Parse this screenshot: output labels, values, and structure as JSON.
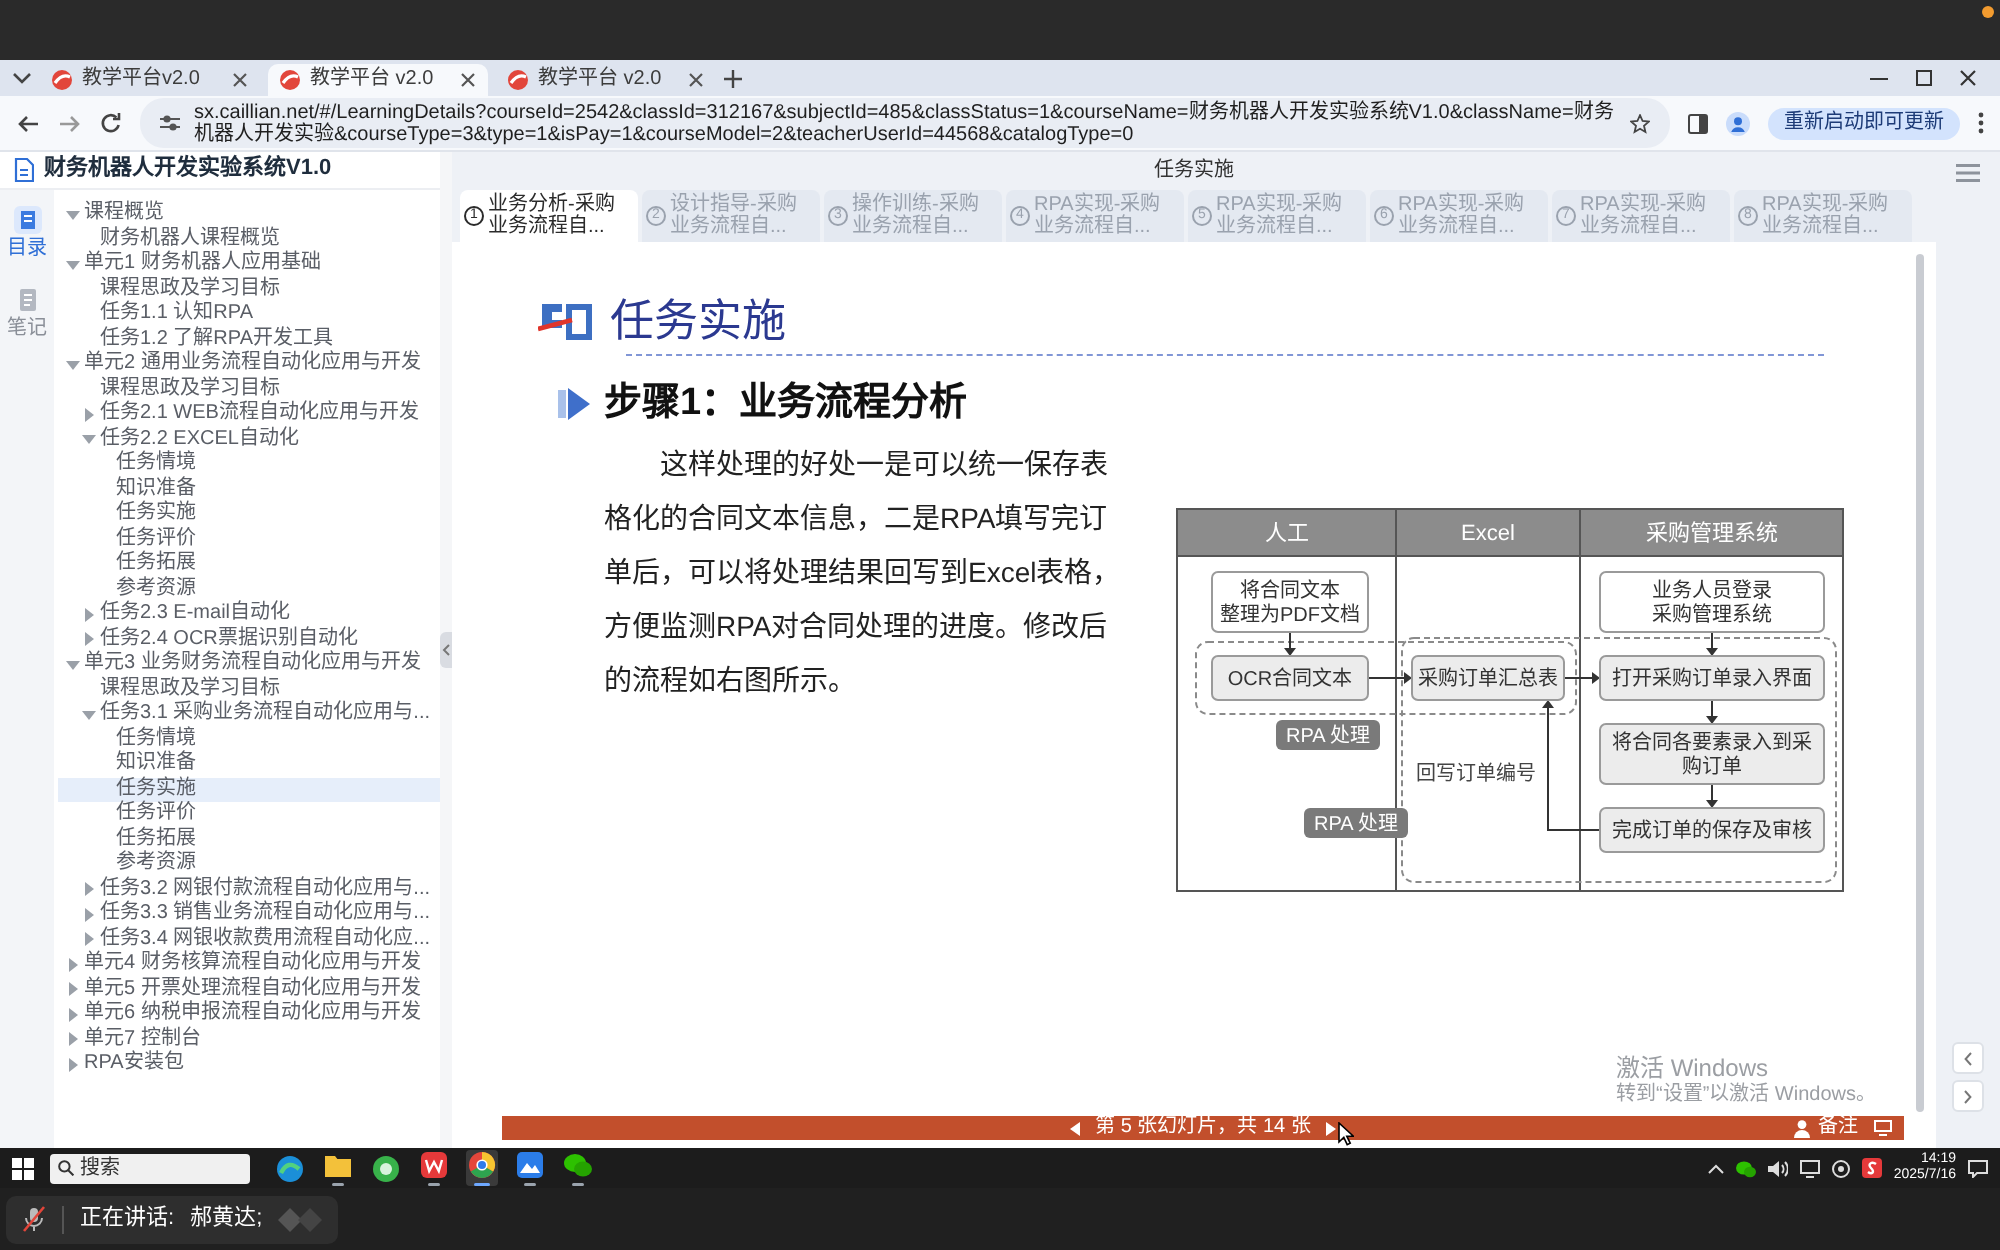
{
  "browser": {
    "tabs": [
      {
        "title": "教学平台v2.0",
        "selected": false
      },
      {
        "title": "教学平台 v2.0",
        "selected": true
      },
      {
        "title": "教学平台 v2.0",
        "selected": false
      }
    ],
    "address": "sx.caillian.net/#/LearningDetails?courseId=2542&classId=312167&subjectId=485&classStatus=1&courseName=财务机器人开发实验系统V1.0&className=财务机器人开发实验&courseType=3&type=1&isPay=1&courseModel=2&teacherUserId=44568&catalogType=0",
    "update_button": "重新启动即可更新"
  },
  "app": {
    "title": "财务机器人开发实验系统V1.0",
    "rail": [
      {
        "kind": "catalog",
        "label": "目录",
        "selected": true
      },
      {
        "kind": "notes",
        "label": "笔记",
        "selected": false
      }
    ],
    "catalog": [
      {
        "label": "课程概览",
        "kind": "group",
        "expanded": true,
        "selected": false,
        "children": [
          {
            "label": "财务机器人课程概览",
            "kind": "page",
            "selected": false
          }
        ]
      },
      {
        "label": "单元1 财务机器人应用基础",
        "kind": "group",
        "expanded": true,
        "selected": false,
        "children": [
          {
            "label": "课程思政及学习目标",
            "kind": "page",
            "selected": false
          },
          {
            "label": "任务1.1 认知RPA",
            "kind": "page",
            "selected": false
          },
          {
            "label": "任务1.2 了解RPA开发工具",
            "kind": "page",
            "selected": false
          }
        ]
      },
      {
        "label": "单元2 通用业务流程自动化应用与开发",
        "kind": "group",
        "expanded": true,
        "selected": false,
        "children": [
          {
            "label": "课程思政及学习目标",
            "kind": "page",
            "selected": false
          },
          {
            "label": "任务2.1 WEB流程自动化应用与开发",
            "kind": "group",
            "expanded": false,
            "selected": false
          },
          {
            "label": "任务2.2 EXCEL自动化",
            "kind": "group",
            "expanded": true,
            "selected": false,
            "children": [
              {
                "label": "任务情境",
                "kind": "page",
                "selected": false
              },
              {
                "label": "知识准备",
                "kind": "page",
                "selected": false
              },
              {
                "label": "任务实施",
                "kind": "page",
                "selected": false
              },
              {
                "label": "任务评价",
                "kind": "page",
                "selected": false
              },
              {
                "label": "任务拓展",
                "kind": "page",
                "selected": false
              },
              {
                "label": "参考资源",
                "kind": "page",
                "selected": false
              }
            ]
          },
          {
            "label": "任务2.3 E-mail自动化",
            "kind": "group",
            "expanded": false,
            "selected": false
          },
          {
            "label": "任务2.4 OCR票据识别自动化",
            "kind": "group",
            "expanded": false,
            "selected": false
          }
        ]
      },
      {
        "label": "单元3 业务财务流程自动化应用与开发",
        "kind": "group",
        "expanded": true,
        "selected": false,
        "children": [
          {
            "label": "课程思政及学习目标",
            "kind": "page",
            "selected": false
          },
          {
            "label": "任务3.1 采购业务流程自动化应用与...",
            "kind": "group",
            "expanded": true,
            "selected": false,
            "children": [
              {
                "label": "任务情境",
                "kind": "page",
                "selected": false
              },
              {
                "label": "知识准备",
                "kind": "page",
                "selected": false
              },
              {
                "label": "任务实施",
                "kind": "page",
                "selected": true
              },
              {
                "label": "任务评价",
                "kind": "page",
                "selected": false
              },
              {
                "label": "任务拓展",
                "kind": "page",
                "selected": false
              },
              {
                "label": "参考资源",
                "kind": "page",
                "selected": false
              }
            ]
          },
          {
            "label": "任务3.2 网银付款流程自动化应用与...",
            "kind": "group",
            "expanded": false,
            "selected": false
          },
          {
            "label": "任务3.3 销售业务流程自动化应用与...",
            "kind": "group",
            "expanded": false,
            "selected": false
          },
          {
            "label": "任务3.4 网银收款费用流程自动化应...",
            "kind": "group",
            "expanded": false,
            "selected": false
          }
        ]
      },
      {
        "label": "单元4 财务核算流程自动化应用与开发",
        "kind": "group",
        "expanded": false,
        "selected": false
      },
      {
        "label": "单元5 开票处理流程自动化应用与开发",
        "kind": "group",
        "expanded": false,
        "selected": false
      },
      {
        "label": "单元6 纳税申报流程自动化应用与开发",
        "kind": "group",
        "expanded": false,
        "selected": false
      },
      {
        "label": "单元7 控制台",
        "kind": "group",
        "expanded": false,
        "selected": false
      },
      {
        "label": "RPA安装包",
        "kind": "group",
        "expanded": false,
        "selected": false
      }
    ]
  },
  "lesson": {
    "title": "任务实施",
    "tabs": [
      {
        "number": "1",
        "label": "业务分析-采购业务流程自...",
        "selected": true
      },
      {
        "number": "2",
        "label": "设计指导-采购业务流程自...",
        "selected": false
      },
      {
        "number": "3",
        "label": "操作训练-采购业务流程自...",
        "selected": false
      },
      {
        "number": "4",
        "label": "RPA实现-采购业务流程自...",
        "selected": false
      },
      {
        "number": "5",
        "label": "RPA实现-采购业务流程自...",
        "selected": false
      },
      {
        "number": "6",
        "label": "RPA实现-采购业务流程自...",
        "selected": false
      },
      {
        "number": "7",
        "label": "RPA实现-采购业务流程自...",
        "selected": false
      },
      {
        "number": "8",
        "label": "RPA实现-采购业务流程自...",
        "selected": false
      }
    ]
  },
  "slide": {
    "heading": "任务实施",
    "step": "步骤1：业务流程分析",
    "paragraph": "这样处理的好处一是可以统一保存表格化的合同文本信息，二是RPA填写完订单后，可以将处理结果回写到Excel表格，方便监测RPA对合同处理的进度。修改后的流程如右图所示。",
    "diagram": {
      "lanes": [
        {
          "title": "人工"
        },
        {
          "title": "Excel"
        },
        {
          "title": "采购管理系统"
        }
      ],
      "steps": [
        {
          "kind": "manual",
          "lines": [
            "将合同文本",
            "整理为PDF文档"
          ]
        },
        {
          "kind": "automated",
          "lines": [
            "OCR合同文本"
          ]
        },
        {
          "kind": "automated",
          "lines": [
            "采购订单汇总表"
          ]
        },
        {
          "kind": "manual",
          "lines": [
            "业务人员登录",
            "采购管理系统"
          ]
        },
        {
          "kind": "automated",
          "lines": [
            "打开采购订单录入界面"
          ]
        },
        {
          "kind": "automated",
          "lines": [
            "将合同各要素录入到采",
            "购订单"
          ]
        },
        {
          "kind": "automated",
          "lines": [
            "完成订单的保存及审核"
          ]
        }
      ],
      "regions": [
        {
          "label": "RPA 处理"
        },
        {
          "label": "RPA 处理"
        }
      ],
      "return_label": "回写订单编号"
    },
    "footer": {
      "counter": "第 5 张幻灯片，共 14 张",
      "notes": "备注"
    }
  },
  "activation_notice": {
    "title": "激活 Windows",
    "hint": "转到“设置”以激活 Windows。"
  },
  "taskbar": {
    "search": {
      "placeholder": "搜索"
    },
    "apps": [
      {
        "kind": "swirl",
        "running": false,
        "selected": false
      },
      {
        "kind": "folder",
        "running": true,
        "selected": false
      },
      {
        "kind": "ring",
        "running": false,
        "selected": false
      },
      {
        "kind": "wlogo",
        "running": true,
        "selected": false
      },
      {
        "kind": "ringlogo",
        "running": true,
        "selected": true
      },
      {
        "kind": "mountain",
        "running": true,
        "selected": false
      },
      {
        "kind": "chat",
        "running": true,
        "selected": false
      }
    ],
    "time": "14:19",
    "date": "2025/7/16"
  },
  "voice_chat": {
    "label": "正在讲话:",
    "speaker": "郝黄达;"
  }
}
